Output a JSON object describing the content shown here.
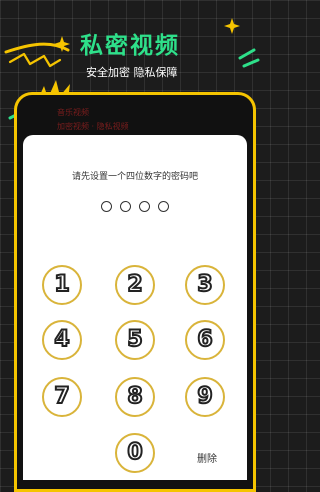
{
  "header": {
    "title": "私密视频",
    "subtitle": "安全加密 隐私保障"
  },
  "background_app": {
    "line1": "音乐视频",
    "line2": "加密视频 · 隐私视频"
  },
  "lock": {
    "prompt": "请先设置一个四位数字的密码吧",
    "entered_digits": 0,
    "total_digits": 4,
    "keys": [
      "1",
      "2",
      "3",
      "4",
      "5",
      "6",
      "7",
      "8",
      "9",
      "0"
    ],
    "delete_label": "删除"
  },
  "colors": {
    "accent_green": "#2ee08a",
    "accent_yellow": "#f5c400",
    "key_ring": "#d9b43a"
  }
}
